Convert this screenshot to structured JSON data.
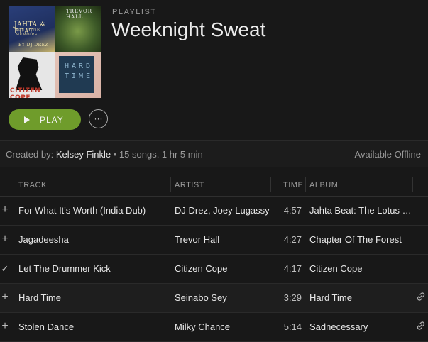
{
  "header": {
    "kind": "PLAYLIST",
    "title": "Weeknight Sweat",
    "art": {
      "tile1_line1": "JAHTA ✲ BEAT",
      "tile1_line2": "THE LOTUS MEMOIRS",
      "tile1_line3": "BY DJ DREZ",
      "tile2_line1": "TREVOR HALL",
      "tile3_line1": "CITIZEN COPE",
      "tile4_line1": "HARD TIME"
    },
    "play_label": "PLAY",
    "more_label": "···",
    "accent_color": "#6f9c2b"
  },
  "meta": {
    "created_by_prefix": "Created by:",
    "owner": "Kelsey Finkle",
    "summary": "• 15 songs, 1 hr 5 min",
    "offline": "Available Offline"
  },
  "columns": {
    "track": "TRACK",
    "artist": "ARTIST",
    "time": "TIME",
    "album": "ALBUM"
  },
  "tracks": [
    {
      "status": "+",
      "title": "For What It's Worth (India Dub)",
      "artist": "DJ Drez, Joey Lugassy",
      "time": "4:57",
      "album": "Jahta Beat: The Lotus Memoirs",
      "has_link_icon": false
    },
    {
      "status": "+",
      "title": "Jagadeesha",
      "artist": "Trevor Hall",
      "time": "4:27",
      "album": "Chapter Of The Forest",
      "has_link_icon": false
    },
    {
      "status": "✓",
      "title": "Let The Drummer Kick",
      "artist": "Citizen Cope",
      "time": "4:17",
      "album": "Citizen Cope",
      "has_link_icon": false
    },
    {
      "status": "+",
      "title": "Hard Time",
      "artist": "Seinabo Sey",
      "time": "3:29",
      "album": "Hard Time",
      "has_link_icon": true
    },
    {
      "status": "+",
      "title": "Stolen Dance",
      "artist": "Milky Chance",
      "time": "5:14",
      "album": "Sadnecessary",
      "has_link_icon": true
    }
  ]
}
